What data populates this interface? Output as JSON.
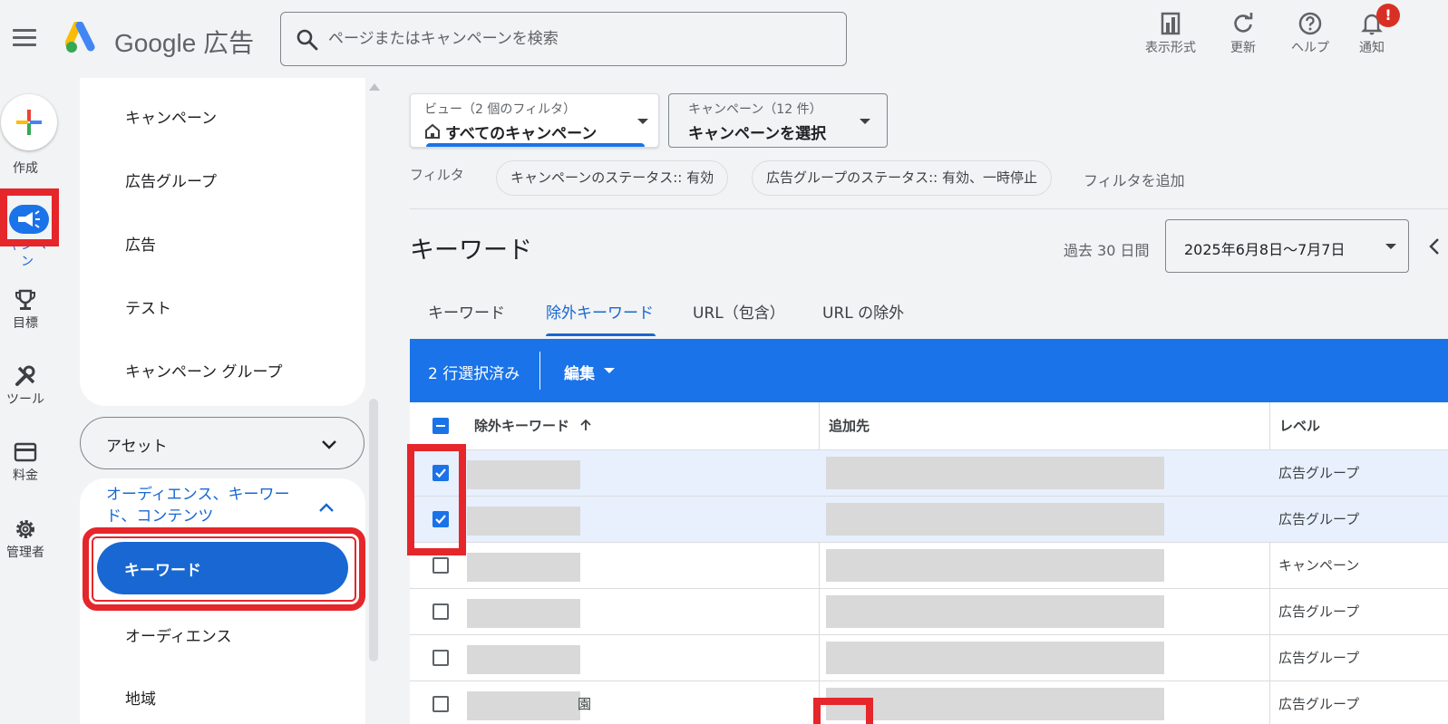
{
  "header": {
    "logo_text": "Google 広告",
    "search_placeholder": "ページまたはキャンペーンを検索",
    "actions": [
      {
        "label": "表示形式",
        "icon": "chart-display-icon"
      },
      {
        "label": "更新",
        "icon": "refresh-icon"
      },
      {
        "label": "ヘルプ",
        "icon": "help-icon"
      },
      {
        "label": "通知",
        "icon": "bell-icon"
      }
    ],
    "notification_badge": "!"
  },
  "rail": {
    "create": "作成",
    "campaign": "キャンペーン",
    "campaign_visible": "ャンペ\nン",
    "goals": "目標",
    "tools": "ツール",
    "billing": "料金",
    "admin": "管理者"
  },
  "nav": {
    "items": [
      "キャンペーン",
      "広告グループ",
      "広告",
      "テスト",
      "キャンペーン グループ"
    ],
    "assets": "アセット",
    "audience_section": "オーディエンス、キーワード、コンテンツ",
    "selected": "キーワード",
    "sub_items": [
      "オーディエンス",
      "地域"
    ]
  },
  "view": {
    "caption": "ビュー（2 個のフィルタ）",
    "value": "すべてのキャンペーン"
  },
  "campaign_select": {
    "caption": "キャンペーン（12 件）",
    "value": "キャンペーンを選択"
  },
  "filters": {
    "label": "フィルタ",
    "chips": [
      "キャンペーンのステータス:: 有効",
      "広告グループのステータス:: 有効、一時停止"
    ],
    "add": "フィルタを追加"
  },
  "page": {
    "title": "キーワード",
    "range_label": "過去 30 日間",
    "date_range": "2025年6月8日～7月7日"
  },
  "tabs": [
    "キーワード",
    "除外キーワード",
    "URL（包含）",
    "URL の除外"
  ],
  "active_tab": "除外キーワード",
  "selection": {
    "count": "2 行選択済み",
    "edit": "編集"
  },
  "table": {
    "headers": [
      "除外キーワード",
      "追加先",
      "レベル"
    ],
    "rows": [
      {
        "level": "広告グループ",
        "checked": true
      },
      {
        "level": "広告グループ",
        "checked": true
      },
      {
        "level": "キャンペーン",
        "checked": false
      },
      {
        "level": "広告グループ",
        "checked": false
      },
      {
        "level": "広告グループ",
        "checked": false
      },
      {
        "level": "広告グループ",
        "checked": false,
        "trail": "園"
      }
    ]
  },
  "colors": {
    "accent": "#1a73e8",
    "annotation": "#e5262b",
    "selected_row": "#e8f0fe"
  }
}
